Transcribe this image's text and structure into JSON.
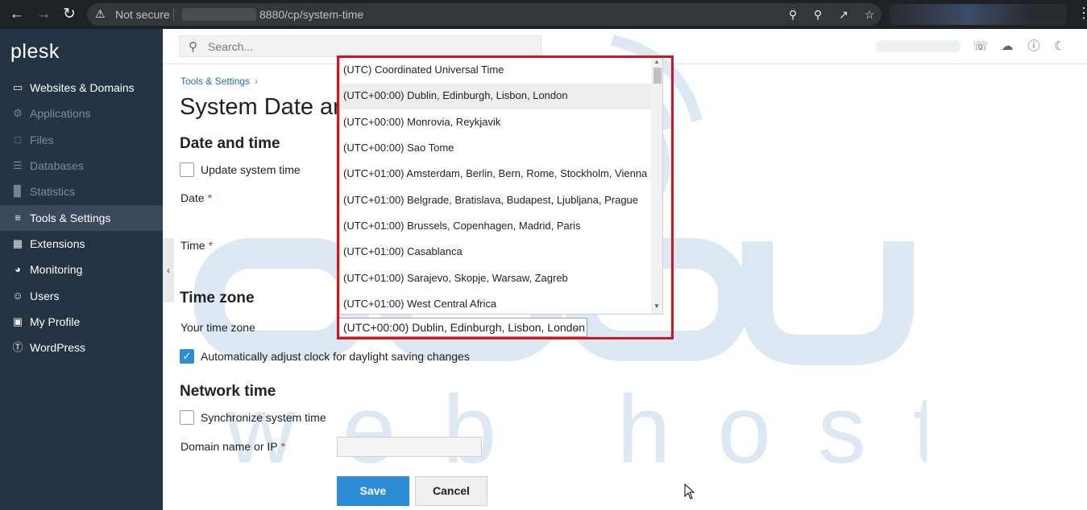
{
  "browser": {
    "security_text": "Not secure",
    "url_visible": "8880/cp/system-time"
  },
  "sidebar": {
    "logo": "plesk",
    "items": [
      {
        "label": "Websites & Domains",
        "icon": "monitor-icon",
        "state": "normal"
      },
      {
        "label": "Applications",
        "icon": "gear-icon",
        "state": "dim"
      },
      {
        "label": "Files",
        "icon": "file-icon",
        "state": "dim"
      },
      {
        "label": "Databases",
        "icon": "database-icon",
        "state": "dim"
      },
      {
        "label": "Statistics",
        "icon": "bar-chart-icon",
        "state": "dim"
      },
      {
        "label": "Tools & Settings",
        "icon": "sliders-icon",
        "state": "active"
      },
      {
        "label": "Extensions",
        "icon": "grid-icon",
        "state": "normal"
      },
      {
        "label": "Monitoring",
        "icon": "pulse-icon",
        "state": "normal"
      },
      {
        "label": "Users",
        "icon": "user-icon",
        "state": "normal"
      },
      {
        "label": "My Profile",
        "icon": "briefcase-icon",
        "state": "normal"
      },
      {
        "label": "WordPress",
        "icon": "wordpress-icon",
        "state": "normal"
      }
    ]
  },
  "header": {
    "search_placeholder": "Search..."
  },
  "main": {
    "breadcrumb": "Tools & Settings",
    "page_title": "System Date and Time",
    "date_section": {
      "title": "Date and time",
      "update_label": "Update system time",
      "date_label": "Date",
      "time_label": "Time"
    },
    "timezone_section": {
      "title": "Time zone",
      "your_tz_label": "Your time zone",
      "selected_tz": "(UTC+00:00) Dublin, Edinburgh, Lisbon, London",
      "auto_adjust_label": "Automatically adjust clock for daylight saving changes",
      "auto_adjust_checked": true
    },
    "network_section": {
      "title": "Network time",
      "sync_label": "Synchronize system time",
      "domain_label": "Domain name or IP"
    },
    "buttons": {
      "save": "Save",
      "cancel": "Cancel"
    }
  },
  "dropdown": {
    "highlighted_index": 1,
    "options": [
      "(UTC) Coordinated Universal Time",
      "(UTC+00:00) Dublin, Edinburgh, Lisbon, London",
      "(UTC+00:00) Monrovia, Reykjavik",
      "(UTC+00:00) Sao Tome",
      "(UTC+01:00) Amsterdam, Berlin, Bern, Rome, Stockholm, Vienna",
      "(UTC+01:00) Belgrade, Bratislava, Budapest, Ljubljana, Prague",
      "(UTC+01:00) Brussels, Copenhagen, Madrid, Paris",
      "(UTC+01:00) Casablanca",
      "(UTC+01:00) Sarajevo, Skopje, Warsaw, Zagreb",
      "(UTC+01:00) West Central Africa"
    ]
  },
  "watermark": {
    "text": "web hosting",
    "color": "#c9dcef"
  },
  "colors": {
    "sidebar_bg": "#253445",
    "accent": "#2c8dd6",
    "highlight_border": "#e0101a"
  }
}
